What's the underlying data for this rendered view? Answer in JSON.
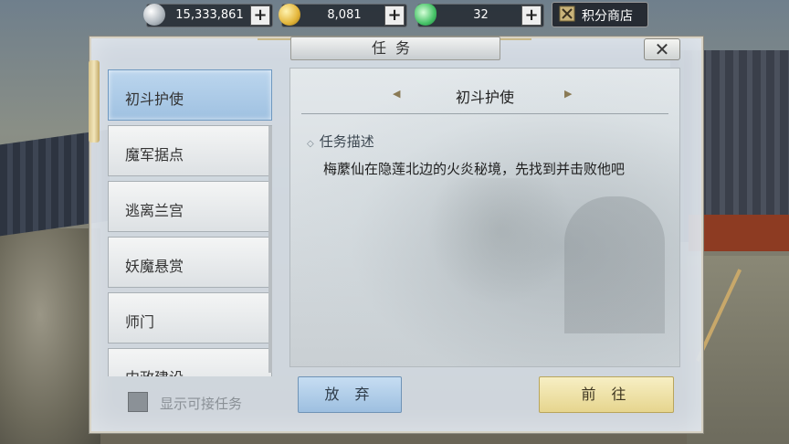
{
  "resources": [
    {
      "icon": "silver-coin-icon",
      "value": "15,333,861"
    },
    {
      "icon": "gold-coin-icon",
      "value": "8,081"
    },
    {
      "icon": "jade-ingot-icon",
      "value": "32"
    }
  ],
  "plus_label": "+",
  "shop": {
    "label": "积分商店"
  },
  "panel": {
    "title": "任务",
    "close": "✕"
  },
  "quest_list": [
    "初斗护使",
    "魔军据点",
    "逃离兰宫",
    "妖魔悬赏",
    "师门",
    "内政建设"
  ],
  "selected_index": 0,
  "show_available": {
    "label": "显示可接任务",
    "checked": false
  },
  "detail": {
    "title": "初斗护使",
    "section_label": "任务描述",
    "description": "梅䕷仙在隐莲北边的火炎秘境，先找到并击败他吧"
  },
  "buttons": {
    "abandon": "放 弃",
    "go": "前 往"
  },
  "colors": {
    "selected_item": "#a9c9e8",
    "abandon_button": "#b1cfeb",
    "go_button": "#eee0a4"
  }
}
